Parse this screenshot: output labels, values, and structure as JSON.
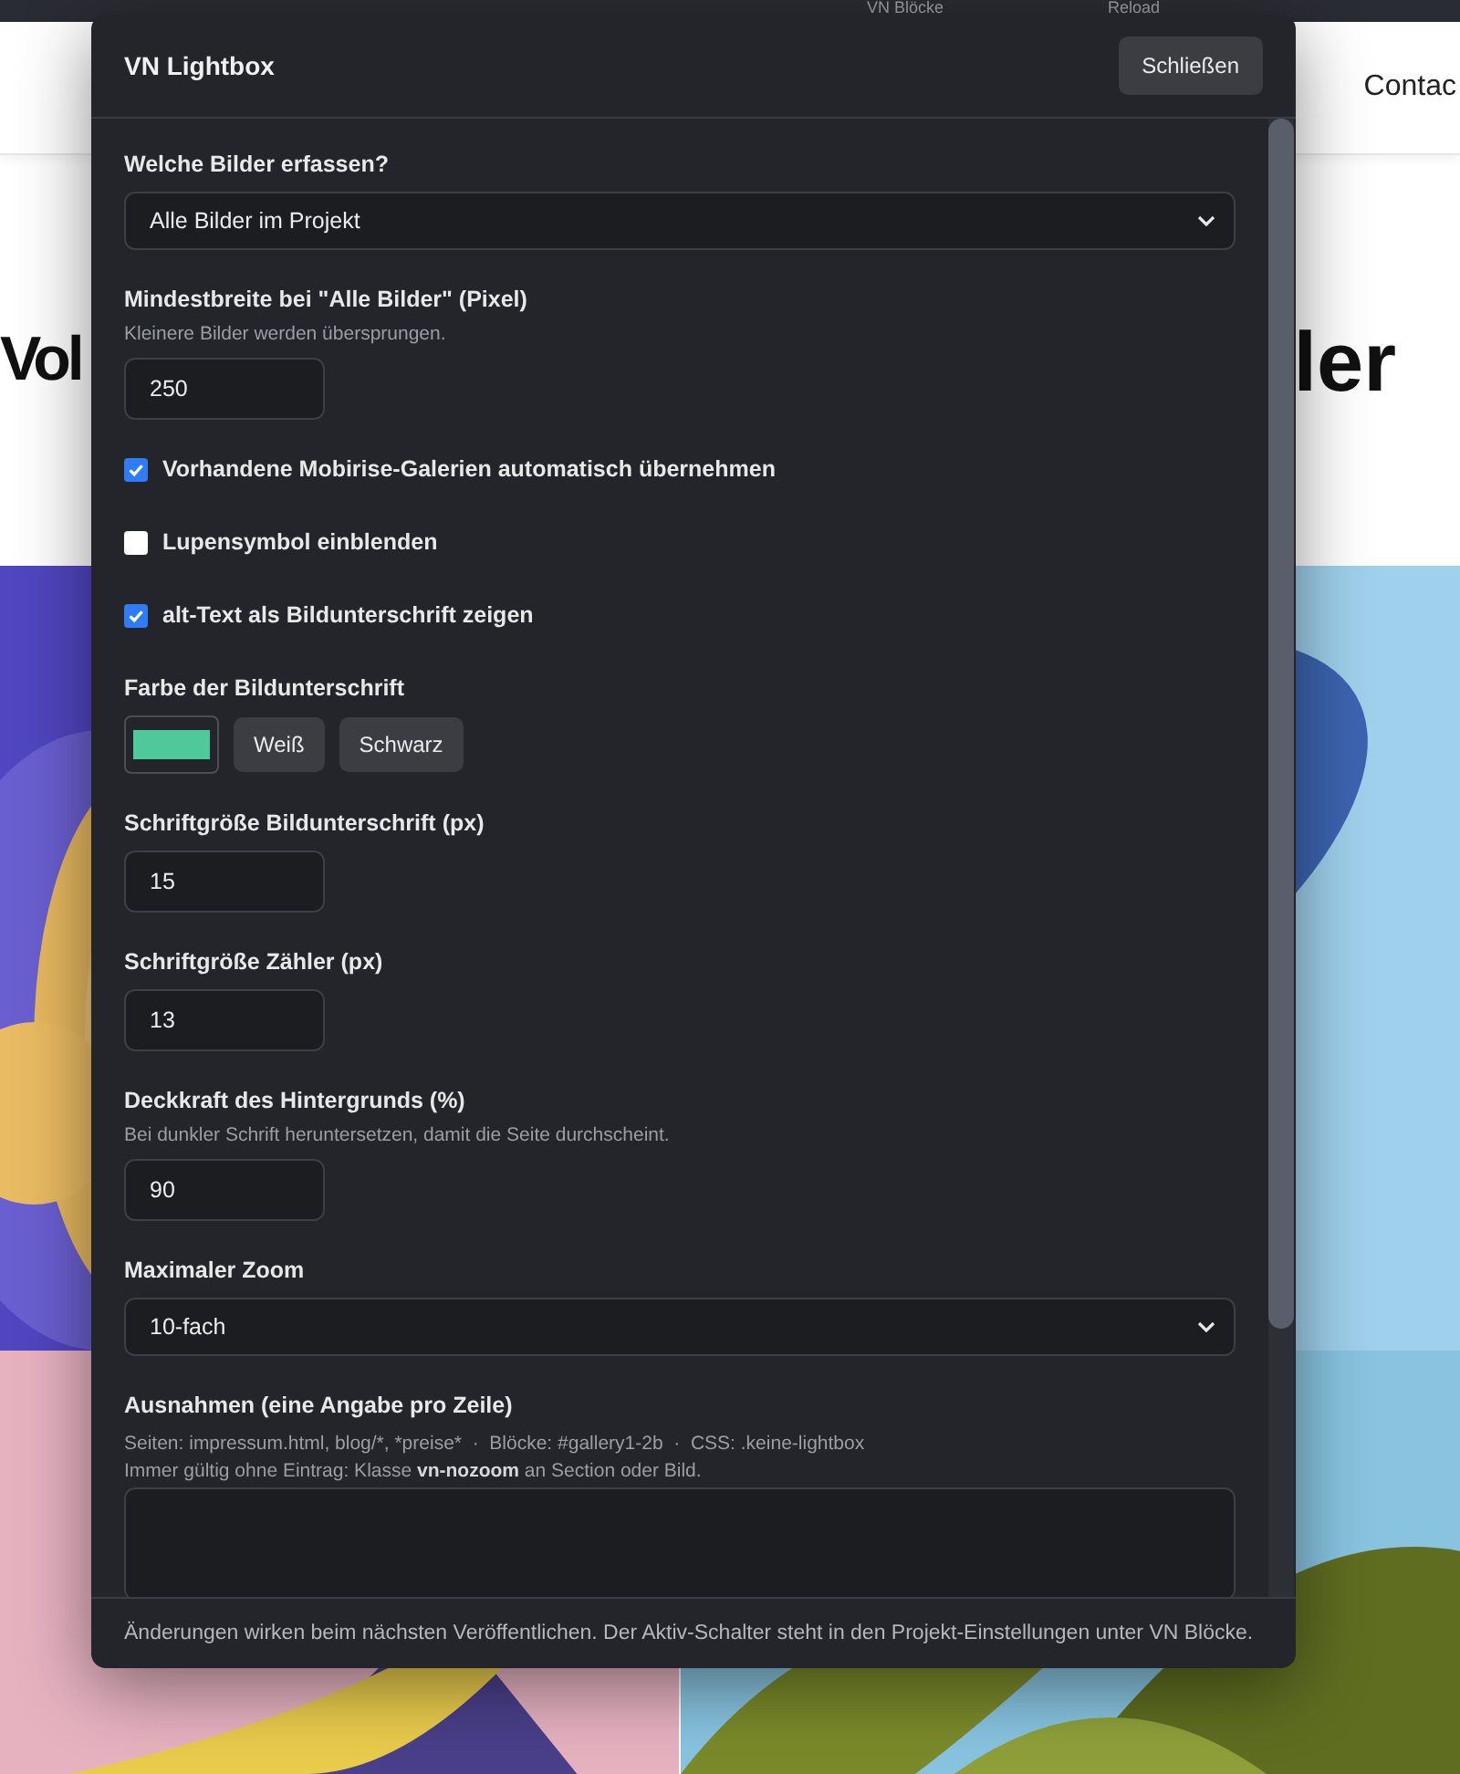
{
  "background_page": {
    "toolbar": {
      "items": [
        "VN Blöcke",
        "Reload"
      ]
    },
    "nav": {
      "link": "Contac"
    },
    "hero": {
      "heading_left": "Vol",
      "heading_right": "ler"
    }
  },
  "dialog": {
    "title": "VN Lightbox",
    "close_button": "Schließen",
    "fields": [
      {
        "kind": "select",
        "label": "Welche Bilder erfassen?",
        "value": "Alle Bilder im Projekt"
      },
      {
        "kind": "number",
        "label": "Mindestbreite bei \"Alle Bilder\" (Pixel)",
        "hint": "Kleinere Bilder werden übersprungen.",
        "value": "250"
      },
      {
        "kind": "checkbox",
        "label": "Vorhandene Mobirise-Galerien automatisch übernehmen",
        "checked": true
      },
      {
        "kind": "checkbox",
        "label": "Lupensymbol einblenden",
        "checked": false
      },
      {
        "kind": "checkbox",
        "label": "alt-Text als Bildunterschrift zeigen",
        "checked": true
      },
      {
        "kind": "color",
        "label": "Farbe der Bildunterschrift",
        "color": "#4ec99a",
        "buttons": [
          "Weiß",
          "Schwarz"
        ]
      },
      {
        "kind": "number",
        "label": "Schriftgröße Bildunterschrift (px)",
        "value": "15"
      },
      {
        "kind": "number",
        "label": "Schriftgröße Zähler (px)",
        "value": "13"
      },
      {
        "kind": "number",
        "label": "Deckkraft des Hintergrunds (%)",
        "hint": "Bei dunkler Schrift heruntersetzen, damit die Seite durchscheint.",
        "value": "90"
      },
      {
        "kind": "select",
        "label": "Maximaler Zoom",
        "value": "10-fach"
      },
      {
        "kind": "textarea",
        "label": "Ausnahmen (eine Angabe pro Zeile)",
        "hints": [
          {
            "kind": "plain",
            "text": "Seiten: impressum.html, blog/*, *preise*  ·  Blöcke: #gallery1-2b  ·  CSS: .keine-lightbox"
          },
          {
            "kind": "rich",
            "text": "Immer gültig ohne Eintrag: Klasse **vn-nozoom** an Section oder Bild."
          }
        ]
      }
    ],
    "footer": "Änderungen wirken beim nächsten Veröffentlichen. Der Aktiv-Schalter steht in den Projekt-Einstellungen unter VN Blöcke."
  }
}
